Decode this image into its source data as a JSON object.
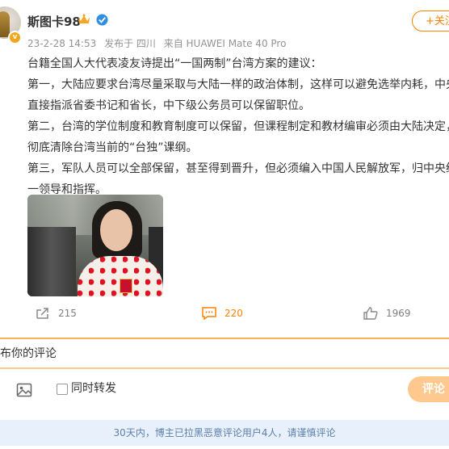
{
  "post": {
    "username": "斯图卡98",
    "meta": {
      "time": "23-2-28 14:53",
      "location": "发布于 四川",
      "source": "来自 HUAWEI Mate 40 Pro"
    },
    "follow_label": "+关注",
    "paragraphs": [
      "台籍全国人大代表凌友诗提出“一国两制”台湾方案的建议：",
      "第一，大陆应要求台湾尽量采取与大陆一样的政治体制，这样可以避免选举内耗，中央",
      "直接指派省委书记和省长，中下级公务员可以保留职位。",
      "第二，台湾的学位制度和教育制度可以保留，但课程制定和教材编审必须由大陆决定，",
      "彻底清除台湾当前的“台独”课纲。",
      "第三，军队人员可以全部保留，甚至得到晋升，但必须编入中国人民解放军，归中央统",
      "一领导和指挥。"
    ],
    "actions": {
      "share_count": "215",
      "comment_count": "220",
      "like_count": "1969"
    }
  },
  "comment_box": {
    "placeholder": "布你的评论",
    "repost_label": "同时转发",
    "submit_label": "评论"
  },
  "notice": "30天内，博主已拉黑恶意评论用户4人，请谨慎评论",
  "colors": {
    "accent": "#ff8200",
    "notice_bg": "#e8f1fb",
    "notice_text": "#5b7fa8"
  }
}
